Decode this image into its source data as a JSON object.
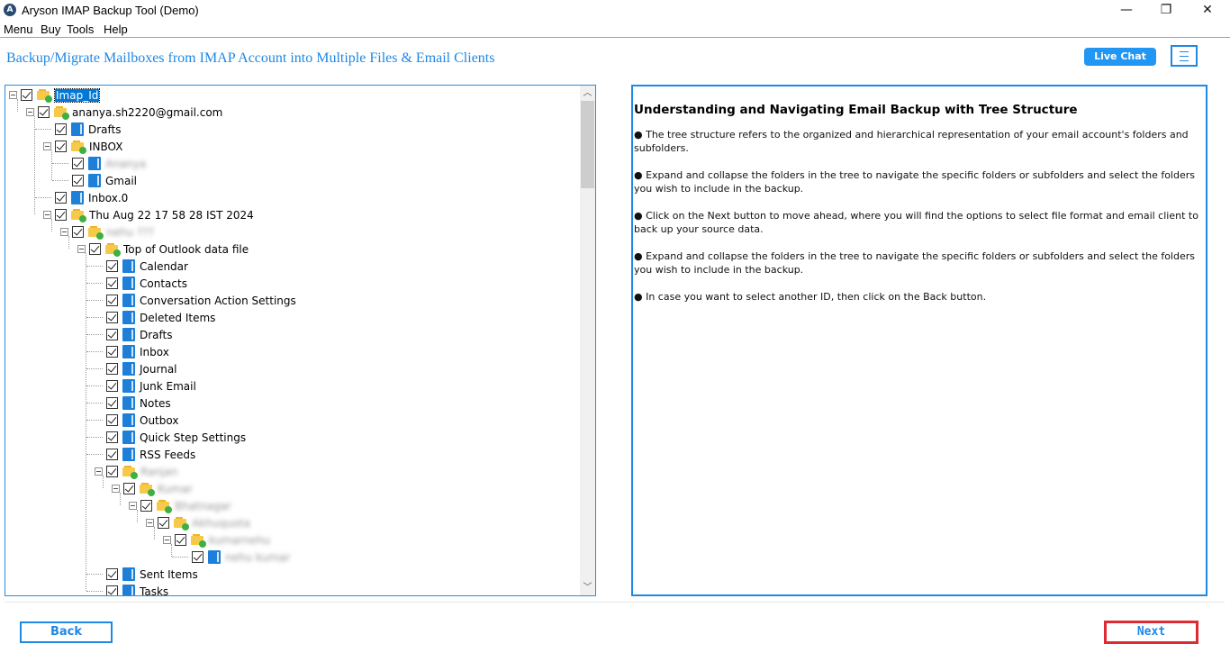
{
  "window": {
    "title": "Aryson IMAP Backup Tool (Demo)",
    "app_icon": "aryson-logo-icon",
    "controls": {
      "minimize": "—",
      "restore": "❐",
      "close": "✕"
    }
  },
  "menubar": {
    "items": [
      "Menu",
      "Buy",
      "Tools",
      "Help"
    ]
  },
  "header": {
    "title": "Backup/Migrate Mailboxes from IMAP Account into Multiple Files & Email Clients",
    "live_chat_label": "Live Chat",
    "menu_icon": "hamburger-icon"
  },
  "tree": {
    "nodes": [
      {
        "label": "Imap_Id",
        "level": 0,
        "icon": "folder",
        "expander": true,
        "checked": true,
        "selected": true
      },
      {
        "label": "ananya.sh2220@gmail.com",
        "level": 1,
        "icon": "folder",
        "expander": true,
        "checked": true
      },
      {
        "label": "Drafts",
        "level": 2,
        "icon": "doc",
        "checked": true
      },
      {
        "label": "INBOX",
        "level": 2,
        "icon": "folder",
        "expander": true,
        "checked": true
      },
      {
        "label": "Ananya",
        "level": 3,
        "icon": "doc",
        "checked": true,
        "redacted": true
      },
      {
        "label": "Gmail",
        "level": 3,
        "icon": "doc",
        "checked": true
      },
      {
        "label": "Inbox.0",
        "level": 2,
        "icon": "doc",
        "checked": true
      },
      {
        "label": "Thu Aug 22 17 58 28 IST 2024",
        "level": 2,
        "icon": "folder",
        "expander": true,
        "checked": true
      },
      {
        "label": "nehu ???",
        "level": 3,
        "icon": "folder",
        "expander": true,
        "checked": true,
        "redacted": true
      },
      {
        "label": "Top of Outlook data file",
        "level": 4,
        "icon": "folder",
        "expander": true,
        "checked": true
      },
      {
        "label": "Calendar",
        "level": 5,
        "icon": "doc",
        "checked": true
      },
      {
        "label": "Contacts",
        "level": 5,
        "icon": "doc",
        "checked": true
      },
      {
        "label": "Conversation Action Settings",
        "level": 5,
        "icon": "doc",
        "checked": true
      },
      {
        "label": "Deleted Items",
        "level": 5,
        "icon": "doc",
        "checked": true
      },
      {
        "label": "Drafts",
        "level": 5,
        "icon": "doc",
        "checked": true
      },
      {
        "label": "Inbox",
        "level": 5,
        "icon": "doc",
        "checked": true
      },
      {
        "label": "Journal",
        "level": 5,
        "icon": "doc",
        "checked": true
      },
      {
        "label": "Junk Email",
        "level": 5,
        "icon": "doc",
        "checked": true
      },
      {
        "label": "Notes",
        "level": 5,
        "icon": "doc",
        "checked": true
      },
      {
        "label": "Outbox",
        "level": 5,
        "icon": "doc",
        "checked": true
      },
      {
        "label": "Quick Step Settings",
        "level": 5,
        "icon": "doc",
        "checked": true
      },
      {
        "label": "RSS Feeds",
        "level": 5,
        "icon": "doc",
        "checked": true
      },
      {
        "label": "Ranjan",
        "level": 5,
        "icon": "folder",
        "expander": true,
        "checked": true,
        "redacted": true
      },
      {
        "label": "Kumar",
        "level": 6,
        "icon": "folder",
        "expander": true,
        "checked": true,
        "redacted": true
      },
      {
        "label": "Bhatnagar",
        "level": 7,
        "icon": "folder",
        "expander": true,
        "checked": true,
        "redacted": true
      },
      {
        "label": "Akhuquota",
        "level": 8,
        "icon": "folder",
        "expander": true,
        "checked": true,
        "redacted": true
      },
      {
        "label": "kumarnehu",
        "level": 9,
        "icon": "folder",
        "expander": true,
        "checked": true,
        "redacted": true
      },
      {
        "label": "nehu kumar",
        "level": 10,
        "icon": "doc",
        "checked": true,
        "redacted": true
      },
      {
        "label": "Sent Items",
        "level": 5,
        "icon": "doc",
        "checked": true
      },
      {
        "label": "Tasks",
        "level": 5,
        "icon": "doc",
        "checked": true
      }
    ],
    "scroll": {
      "up_icon": "chevron-up-icon",
      "down_icon": "chevron-down-icon"
    }
  },
  "info": {
    "title": "Understanding and Navigating Email Backup with Tree Structure",
    "bullets": [
      "● The tree structure refers to the organized and hierarchical representation of your email account's folders and subfolders.",
      "● Expand and collapse the folders in the tree to navigate the specific folders or subfolders and select the folders you wish to include in the backup.",
      "● Click on the Next button to move ahead, where you will find the options to select file format and email client to back up your source data.",
      "● Expand and collapse the folders in the tree to navigate the specific folders or subfolders and select the folders you wish to include in the backup.",
      "● In case you want to select another ID, then click on the Back button."
    ]
  },
  "footer": {
    "back_label": "Back",
    "next_label": "Next"
  },
  "colors": {
    "accent": "#1e88e5",
    "highlight": "#e02a32",
    "selection": "#0078d7"
  }
}
